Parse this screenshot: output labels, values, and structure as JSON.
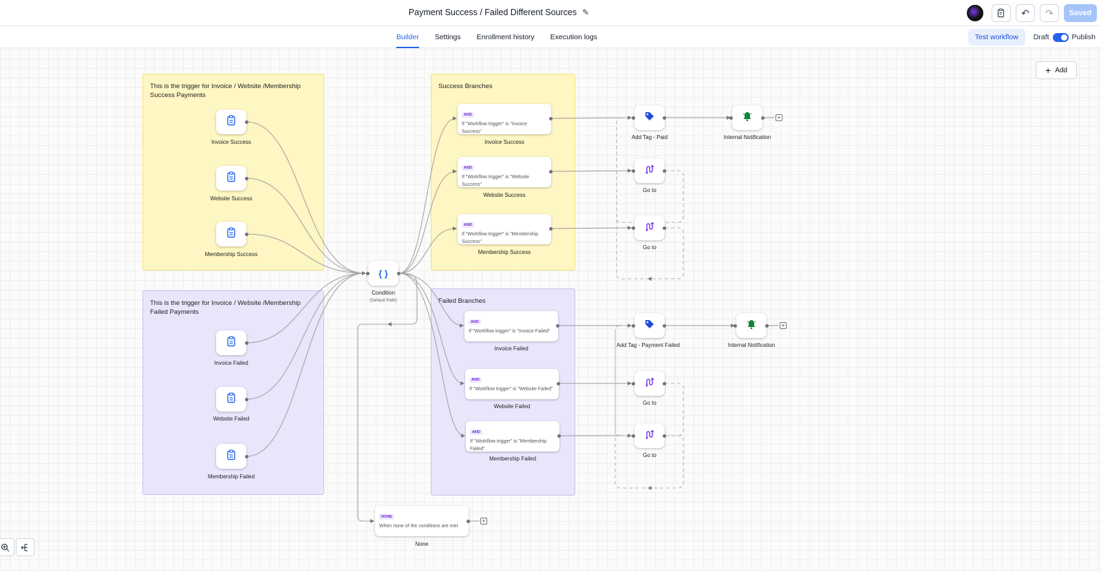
{
  "header": {
    "title": "Payment Success / Failed Different Sources",
    "saved_label": "Saved"
  },
  "tabs": [
    {
      "label": "Builder",
      "active": true
    },
    {
      "label": "Settings"
    },
    {
      "label": "Enrollment history"
    },
    {
      "label": "Execution logs"
    }
  ],
  "controls": {
    "test_workflow": "Test workflow",
    "draft": "Draft",
    "publish": "Publish",
    "publish_toggle_on": true,
    "add": "Add"
  },
  "groups": {
    "success_triggers": "This is the trigger for Invoice / Website /Membership Success Payments",
    "failed_triggers": "This is the trigger for Invoice / Website /Membership Failed Payments",
    "success_branches": "Success Branches",
    "failed_branches": "Failed Branches"
  },
  "triggers": {
    "invoice_success": "Invoice Success",
    "website_success": "Website Success",
    "membership_success": "Membership Success",
    "invoice_failed": "Invoice Failed",
    "website_failed": "Website Failed",
    "membership_failed": "Membership Failed"
  },
  "condition": {
    "label": "Condition",
    "sub": "(Default Path)"
  },
  "branches": {
    "invoice_success": {
      "badge": "AND",
      "text": "If \"Workflow trigger\" is \"Invoice Success\"",
      "label": "Invoice Success"
    },
    "website_success": {
      "badge": "AND",
      "text": "If \"Workflow trigger\" is \"Website Success\"",
      "label": "Website Success"
    },
    "membership_success": {
      "badge": "AND",
      "text": "If \"Workflow trigger\" is \"Membership Success\"",
      "label": "Membership Success"
    },
    "invoice_failed": {
      "badge": "AND",
      "text": "If \"Workflow trigger\" is \"Invoice Failed\"",
      "label": "Invoice Failed"
    },
    "website_failed": {
      "badge": "AND",
      "text": "If \"Workflow trigger\" is \"Website Failed\"",
      "label": "Website Failed"
    },
    "membership_failed": {
      "badge": "AND",
      "text": "If \"Workflow trigger\" is \"Membership Failed\"",
      "label": "Membership Failed"
    },
    "none": {
      "badge": "NONE",
      "text": "When none of the conditions are met",
      "label": "None"
    }
  },
  "actions": {
    "add_tag_paid": "Add Tag - Paid",
    "add_tag_payment_failed": "Add Tag - Payment Failed",
    "internal_notification": "Internal Notification",
    "go_to": "Go to"
  },
  "colors": {
    "accent": "#2563eb",
    "trigger_icon": "#2563eb",
    "tag_icon": "#1d4ed8",
    "bell_icon": "#15803d",
    "goto_icon": "#7c3aed",
    "success_group": "#fef6c3",
    "failed_group": "#e9e6fb"
  }
}
